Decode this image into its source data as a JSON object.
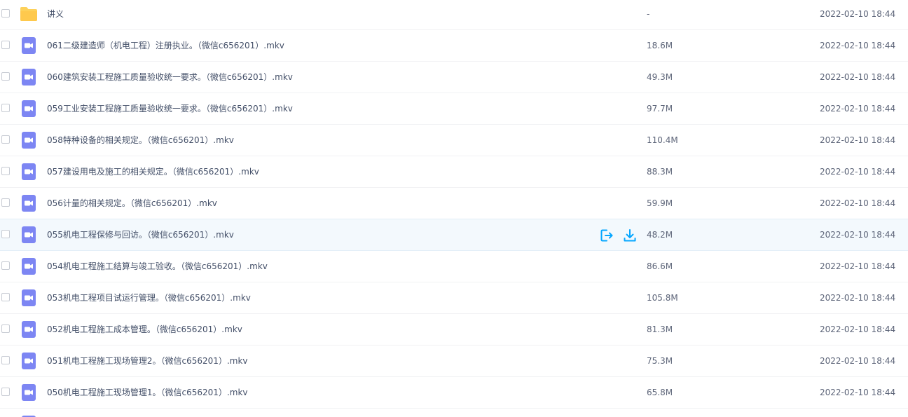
{
  "files": [
    {
      "name": "讲义",
      "type": "folder",
      "size": "-",
      "date": "2022-02-10 18:44"
    },
    {
      "name": "061二级建造师（机电工程）注册执业。（微信c656201）.mkv",
      "type": "video",
      "size": "18.6M",
      "date": "2022-02-10 18:44"
    },
    {
      "name": "060建筑安装工程施工质量验收统一要求。（微信c656201）.mkv",
      "type": "video",
      "size": "49.3M",
      "date": "2022-02-10 18:44"
    },
    {
      "name": "059工业安装工程施工质量验收统一要求。（微信c656201）.mkv",
      "type": "video",
      "size": "97.7M",
      "date": "2022-02-10 18:44"
    },
    {
      "name": "058特种设备的相关规定。（微信c656201）.mkv",
      "type": "video",
      "size": "110.4M",
      "date": "2022-02-10 18:44"
    },
    {
      "name": "057建设用电及施工的相关规定。（微信c656201）.mkv",
      "type": "video",
      "size": "88.3M",
      "date": "2022-02-10 18:44"
    },
    {
      "name": "056计量的相关规定。（微信c656201）.mkv",
      "type": "video",
      "size": "59.9M",
      "date": "2022-02-10 18:44"
    },
    {
      "name": "055机电工程保修与回访。（微信c656201）.mkv",
      "type": "video",
      "size": "48.2M",
      "date": "2022-02-10 18:44",
      "hovered": true
    },
    {
      "name": "054机电工程施工结算与竣工验收。（微信c656201）.mkv",
      "type": "video",
      "size": "86.6M",
      "date": "2022-02-10 18:44"
    },
    {
      "name": "053机电工程项目试运行管理。（微信c656201）.mkv",
      "type": "video",
      "size": "105.8M",
      "date": "2022-02-10 18:44"
    },
    {
      "name": "052机电工程施工成本管理。（微信c656201）.mkv",
      "type": "video",
      "size": "81.3M",
      "date": "2022-02-10 18:44"
    },
    {
      "name": "051机电工程施工现场管理2。（微信c656201）.mkv",
      "type": "video",
      "size": "75.3M",
      "date": "2022-02-10 18:44"
    },
    {
      "name": "050机电工程施工现场管理1。（微信c656201）.mkv",
      "type": "video",
      "size": "65.8M",
      "date": "2022-02-10 18:44"
    }
  ],
  "icons": {
    "folder": "folder-icon",
    "video": "video-file-icon",
    "share": "share-icon",
    "download": "download-icon"
  },
  "colors": {
    "folder": "#fdd15a",
    "video": "#7d86f3",
    "accent": "#06a7ff",
    "hover_row": "#f3f9fd"
  }
}
